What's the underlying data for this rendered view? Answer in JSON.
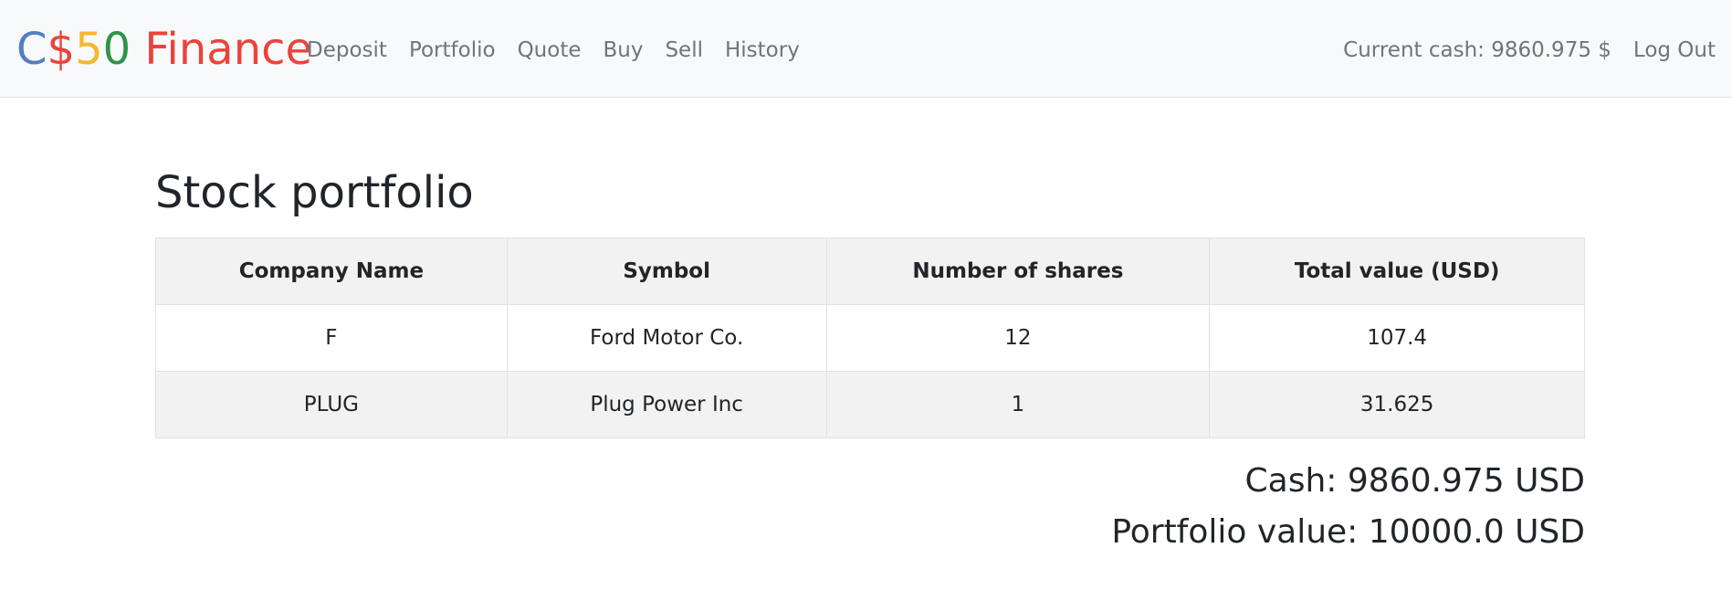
{
  "navbar": {
    "brand": {
      "c": "C",
      "dollar": "$",
      "five": "5",
      "zero": "0",
      "finance": " Finance"
    },
    "brand_colors": {
      "c": "#537fbe",
      "dollar": "#ea433b",
      "five": "#f5b82e",
      "zero": "#2e944b",
      "finance": "#ea433b"
    },
    "links": [
      "Deposit",
      "Portfolio",
      "Quote",
      "Buy",
      "Sell",
      "History"
    ],
    "current_cash": "Current cash: 9860.975 $",
    "logout": "Log Out"
  },
  "main": {
    "title": "Stock portfolio",
    "table": {
      "headers": [
        "Company Name",
        "Symbol",
        "Number of shares",
        "Total value (USD)"
      ],
      "rows": [
        [
          "F",
          "Ford Motor Co.",
          "12",
          "107.4"
        ],
        [
          "PLUG",
          "Plug Power Inc",
          "1",
          "31.625"
        ]
      ]
    },
    "cash": "Cash: 9860.975 USD",
    "portfolio_value": "Portfolio value: 10000.0 USD"
  }
}
